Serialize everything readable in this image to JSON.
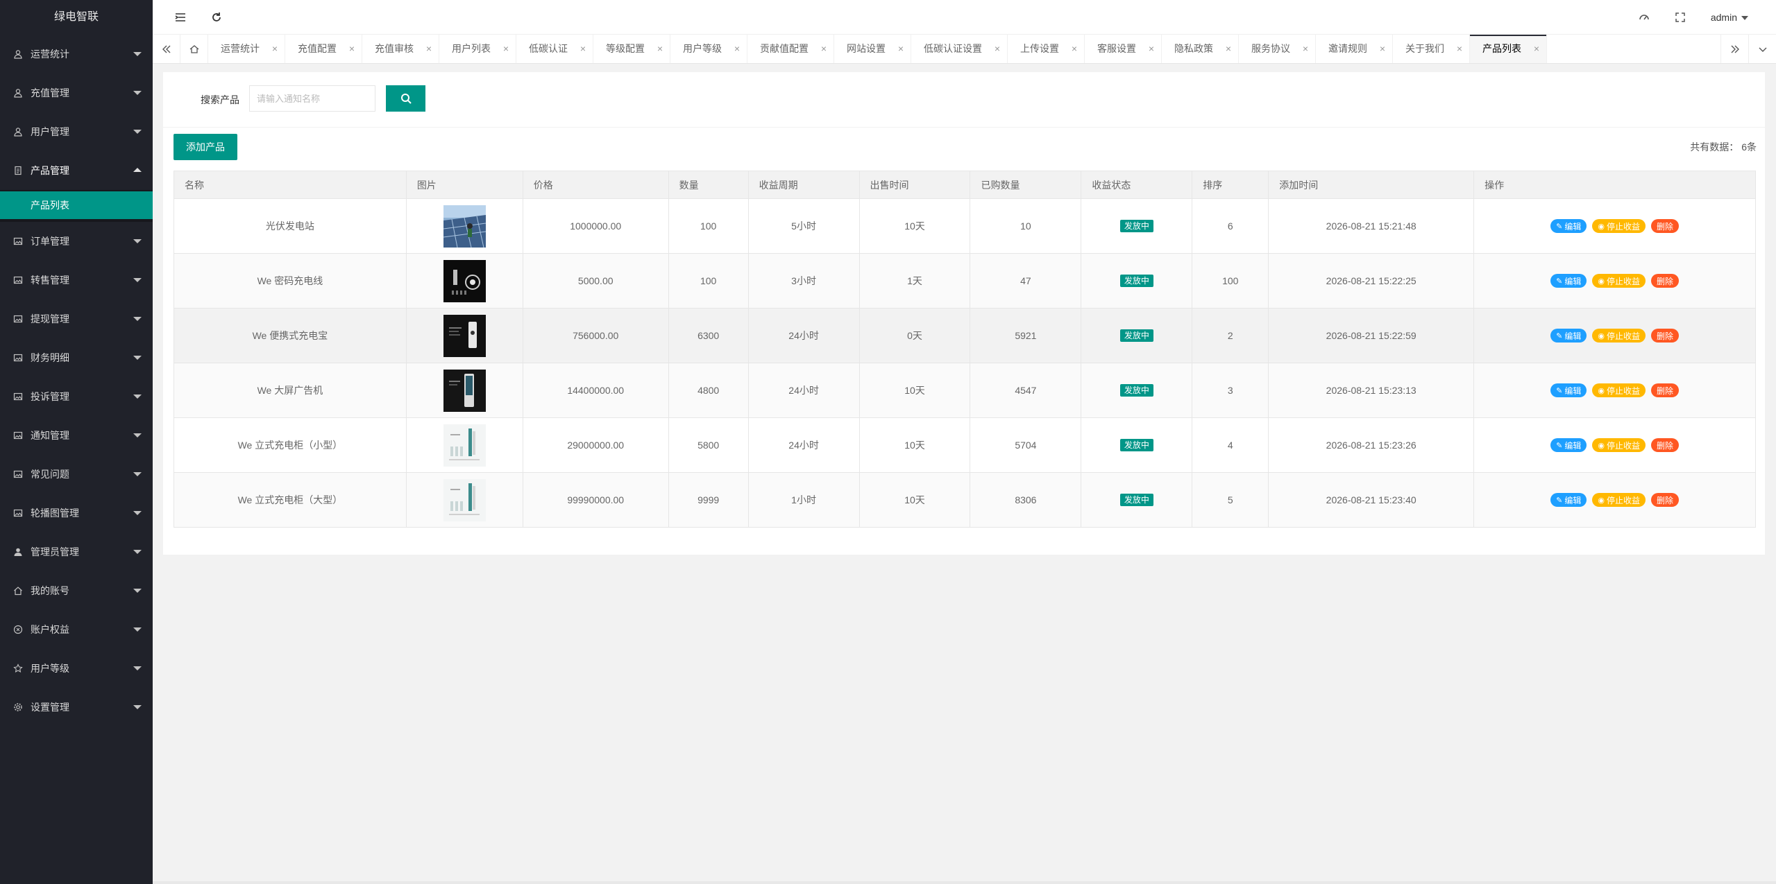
{
  "app": {
    "title": "绿电智联"
  },
  "sidebar": {
    "items": [
      {
        "label": "运营统计",
        "icon": "user-icon"
      },
      {
        "label": "充值管理",
        "icon": "user-icon"
      },
      {
        "label": "用户管理",
        "icon": "user-icon"
      },
      {
        "label": "产品管理",
        "icon": "document-icon",
        "open": true,
        "children": [
          {
            "label": "产品列表"
          }
        ]
      },
      {
        "label": "订单管理",
        "icon": "image-icon"
      },
      {
        "label": "转售管理",
        "icon": "image-icon"
      },
      {
        "label": "提现管理",
        "icon": "image-icon"
      },
      {
        "label": "财务明细",
        "icon": "image-icon"
      },
      {
        "label": "投诉管理",
        "icon": "image-icon"
      },
      {
        "label": "通知管理",
        "icon": "image-icon"
      },
      {
        "label": "常见问题",
        "icon": "image-icon"
      },
      {
        "label": "轮播图管理",
        "icon": "image-icon"
      },
      {
        "label": "管理员管理",
        "icon": "person-icon"
      },
      {
        "label": "我的账号",
        "icon": "home-icon"
      },
      {
        "label": "账户权益",
        "icon": "circle-icon"
      },
      {
        "label": "用户等级",
        "icon": "star-icon"
      },
      {
        "label": "设置管理",
        "icon": "gear-icon"
      }
    ]
  },
  "header": {
    "user": "admin"
  },
  "tabs": [
    "运营统计",
    "充值配置",
    "充值审核",
    "用户列表",
    "低碳认证",
    "等级配置",
    "用户等级",
    "贡献值配置",
    "网站设置",
    "低碳认证设置",
    "上传设置",
    "客服设置",
    "隐私政策",
    "服务协议",
    "邀请规则",
    "关于我们",
    "产品列表"
  ],
  "tab_close": "×",
  "search": {
    "label": "搜索产品",
    "placeholder": "请输入通知名称"
  },
  "toolbar": {
    "add_label": "添加产品",
    "total_label": "共有数据：",
    "total_value": "6条"
  },
  "table": {
    "headers": [
      "名称",
      "图片",
      "价格",
      "数量",
      "收益周期",
      "出售时间",
      "已购数量",
      "收益状态",
      "排序",
      "添加时间",
      "操作"
    ],
    "rows": [
      {
        "name": "光伏发电站",
        "price": "1000000.00",
        "qty": "100",
        "cycle": "5小时",
        "sale": "10天",
        "bought": "10",
        "status": "发放中",
        "sort": "6",
        "time": "2026-08-21 15:21:48"
      },
      {
        "name": "We 密码充电线",
        "price": "5000.00",
        "qty": "100",
        "cycle": "3小时",
        "sale": "1天",
        "bought": "47",
        "status": "发放中",
        "sort": "100",
        "time": "2026-08-21 15:22:25"
      },
      {
        "name": "We 便携式充电宝",
        "price": "756000.00",
        "qty": "6300",
        "cycle": "24小时",
        "sale": "0天",
        "bought": "5921",
        "status": "发放中",
        "sort": "2",
        "time": "2026-08-21 15:22:59"
      },
      {
        "name": "We 大屏广告机",
        "price": "14400000.00",
        "qty": "4800",
        "cycle": "24小时",
        "sale": "10天",
        "bought": "4547",
        "status": "发放中",
        "sort": "3",
        "time": "2026-08-21 15:23:13"
      },
      {
        "name": "We 立式充电柜（小型）",
        "price": "29000000.00",
        "qty": "5800",
        "cycle": "24小时",
        "sale": "10天",
        "bought": "5704",
        "status": "发放中",
        "sort": "4",
        "time": "2026-08-21 15:23:26"
      },
      {
        "name": "We 立式充电柜（大型）",
        "price": "99990000.00",
        "qty": "9999",
        "cycle": "1小时",
        "sale": "10天",
        "bought": "8306",
        "status": "发放中",
        "sort": "5",
        "time": "2026-08-21 15:23:40"
      }
    ],
    "actions": {
      "edit": "编辑",
      "stop": "停止收益",
      "delete": "删除"
    }
  },
  "colors": {
    "sidebar_bg": "#20222a",
    "accent": "#009688",
    "edit": "#1e9fff",
    "stop": "#ffb800",
    "delete": "#ff5722"
  }
}
